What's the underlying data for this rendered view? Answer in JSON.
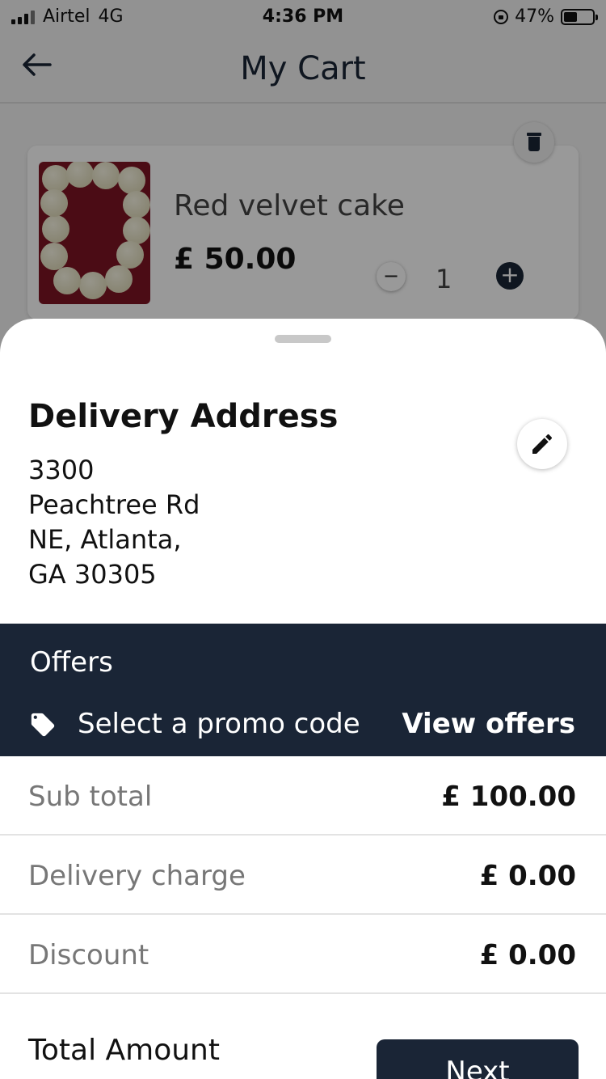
{
  "status_bar": {
    "carrier": "Airtel",
    "network": "4G",
    "time": "4:36 PM",
    "battery": "47%",
    "battery_level": 0.47
  },
  "header": {
    "title": "My Cart",
    "back_icon": "arrow-left-icon"
  },
  "cart_item": {
    "name": "Red velvet cake",
    "price": "£ 50.00",
    "quantity": "1",
    "minus_label": "−",
    "plus_label": "+",
    "delete_icon": "trash-icon"
  },
  "sheet": {
    "address_title": "Delivery Address",
    "address_lines": [
      "3300",
      "Peachtree Rd",
      "NE, Atlanta,",
      "GA 30305"
    ],
    "edit_icon": "pencil-icon",
    "offers": {
      "title": "Offers",
      "promo_placeholder": "Select a promo code",
      "view_offers": "View offers",
      "promo_icon": "tag-icon"
    },
    "summary": [
      {
        "label": "Sub total",
        "value": "£ 100.00"
      },
      {
        "label": "Delivery charge",
        "value": "£ 0.00"
      },
      {
        "label": "Discount",
        "value": "£ 0.00"
      }
    ],
    "total_label": "Total Amount",
    "next_button": "Next"
  },
  "colors": {
    "primary": "#1a2536",
    "cake": "#7d1524",
    "muted_text": "#777777"
  }
}
